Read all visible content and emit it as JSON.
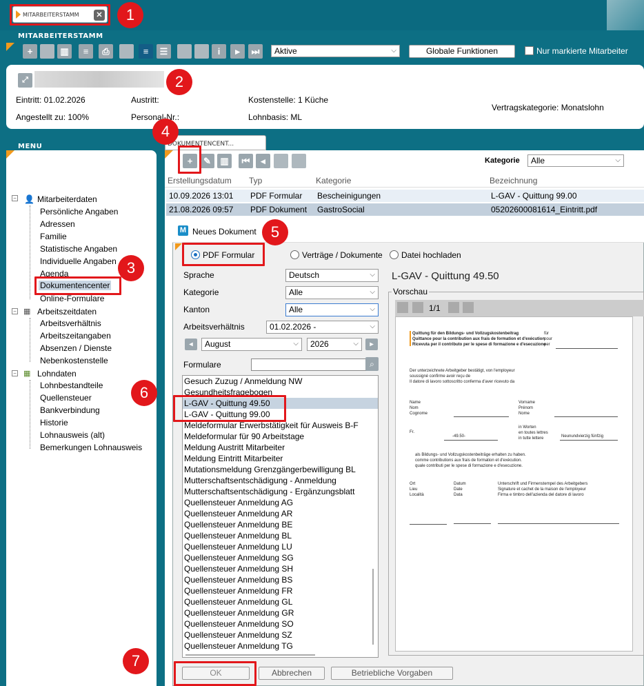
{
  "tabs": {
    "active": "MITARBEITERSTAMM"
  },
  "badges": [
    "1",
    "2",
    "3",
    "4",
    "5",
    "6",
    "7"
  ],
  "employee": {
    "section_title": "MITARBEITERSTAMM",
    "filter_value": "Aktive",
    "global_functions": "Globale Funktionen",
    "only_marked_label": "Nur markierte Mitarbeiter",
    "eintritt": "Eintritt: 01.02.2026",
    "austritt": "Austritt:",
    "kostenstelle": "Kostenstelle: 1 Küche",
    "angestellt": "Angestellt zu: 100%",
    "personal_nr": "Personal-Nr.:",
    "lohnbasis": "Lohnbasis: ML",
    "vertragskategorie": "Vertragskategorie: Monatslohn"
  },
  "menu": {
    "title": "MENU",
    "groups": [
      {
        "label": "Mitarbeiterdaten",
        "items": [
          "Persönliche Angaben",
          "Adressen",
          "Familie",
          "Statistische Angaben",
          "Individuelle Angaben",
          "Agenda",
          "Dokumentencenter",
          "Online-Formulare"
        ]
      },
      {
        "label": "Arbeitszeitdaten",
        "items": [
          "Arbeitsverhältnis",
          "Arbeitszeitangaben",
          "Absenzen / Dienste",
          "Nebenkostenstelle"
        ]
      },
      {
        "label": "Lohndaten",
        "items": [
          "Lohnbestandteile",
          "Quellensteuer",
          "Bankverbindung",
          "Historie",
          "Lohnausweis (alt)",
          "Bemerkungen Lohnausweis"
        ]
      }
    ]
  },
  "doc": {
    "tab_label": "DOKUMENTENCENT...",
    "kategorie_label": "Kategorie",
    "kategorie_value": "Alle",
    "columns": [
      "Erstellungsdatum",
      "Typ",
      "Kategorie",
      "Bezeichnung"
    ],
    "rows": [
      [
        "10.09.2026 13:01",
        "PDF Formular",
        "Bescheinigungen",
        "L-GAV - Quittung 99.00"
      ],
      [
        "21.08.2026 09:57",
        "PDF Dokument",
        "GastroSocial",
        "05202600081614_Eintritt.pdf"
      ]
    ]
  },
  "dialog": {
    "title": "Neues Dokument",
    "logo": "M",
    "radio_pdf": "PDF Formular",
    "radio_vertraege": "Verträge / Dokumente",
    "radio_upload": "Datei hochladen",
    "sprache_label": "Sprache",
    "sprache_value": "Deutsch",
    "kategorie_label": "Kategorie",
    "kategorie_value": "Alle",
    "kanton_label": "Kanton",
    "kanton_value": "Alle",
    "av_label": "Arbeitsverhältnis",
    "av_value": "01.02.2026 -",
    "month_value": "August",
    "year_value": "2026",
    "formulare_label": "Formulare",
    "formulare": [
      "Gesuch Zuzug / Anmeldung NW",
      "Gesundheitsfragebogen",
      "L-GAV - Quittung 49.50",
      "L-GAV - Quittung 99.00",
      "Meldeformular Erwerbstätigkeit für Ausweis B-F",
      "Meldeformular für 90 Arbeitstage",
      "Meldung Austritt Mitarbeiter",
      "Meldung Eintritt Mitarbeiter",
      "Mutationsmeldung Grenzgängerbewilligung BL",
      "Mutterschaftsentschädigung - Anmeldung",
      "Mutterschaftsentschädigung - Ergänzungsblatt",
      "Quellensteuer Anmeldung AG",
      "Quellensteuer Anmeldung AR",
      "Quellensteuer Anmeldung BE",
      "Quellensteuer Anmeldung BL",
      "Quellensteuer Anmeldung LU",
      "Quellensteuer Anmeldung SG",
      "Quellensteuer Anmeldung SH",
      "Quellensteuer Anmeldung  BS",
      "Quellensteuer Anmeldung  FR",
      "Quellensteuer Anmeldung  GL",
      "Quellensteuer Anmeldung  GR",
      "Quellensteuer Anmeldung  SO",
      "Quellensteuer Anmeldung  SZ",
      "Quellensteuer Anmeldung  TG"
    ],
    "selected_title": "L-GAV - Quittung 49.50",
    "vorschau_label": "Vorschau",
    "page_indicator": "1/1",
    "ok": "OK",
    "cancel": "Abbrechen",
    "betrieb": "Betriebliche Vorgaben"
  },
  "preview": {
    "h1": "Quittung für den Bildungs- und Vollzugskostenbeitrag",
    "h2": "Quittance pour la contribution aux frais de formation et d'exécution",
    "h3": "Ricevuta per il contributo per le spese di formazione e d'esecuzione",
    "fur": "für",
    "pour": "pour",
    "per": "per",
    "p1": "Der unterzeichnete Arbeitgeber bestätigt, von l'employeur",
    "p2": "soussigné confirme avoir reçu de",
    "p3": "Il datore di lavoro sottoscritto conferma d'aver ricevuto da",
    "name": "Name",
    "nom": "Nom",
    "cognome": "Cognome",
    "vorname": "Vorname",
    "prenom": "Prénom",
    "nome": "Nome",
    "fr": "Fr.",
    "amount": "-49.50-",
    "inworten": "in Worten",
    "entoutes": "en toutes lettres",
    "intutte": "in tutte lettere",
    "words": "Neunundvierzig fünfzig",
    "als1": "als Bildungs- und Vollzugskostenbeiträge erhalten zu haben.",
    "als2": "comme contributions aux frais de formation et d'exécution.",
    "als3": "quale contributi per le spese di formazione e d'esecuzione.",
    "ort": "Ort",
    "lieu": "Lieu",
    "localita": "Località",
    "datum": "Datum",
    "date": "Date",
    "data": "Data",
    "sig1": "Unterschrift und Firmenstempel des Arbeitgebers",
    "sig2": "Signature et cachet de la maison de l'employeur",
    "sig3": "Firma e timbro dell'azienda del datore di lavoro"
  }
}
